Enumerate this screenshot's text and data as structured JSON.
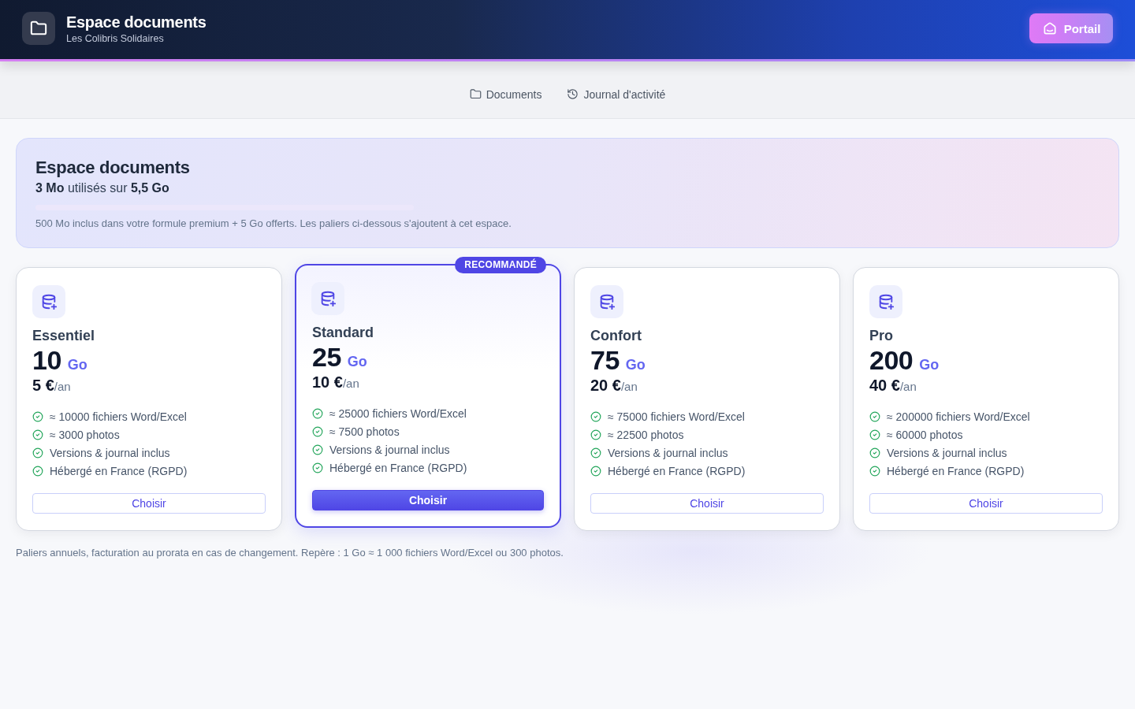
{
  "header": {
    "title": "Espace documents",
    "subtitle": "Les Colibris Solidaires",
    "button": "Portail"
  },
  "tabs": [
    {
      "kind": "folder",
      "label": "Documents",
      "selected": false
    },
    {
      "kind": "history",
      "label": "Journal d'activité",
      "selected": false
    }
  ],
  "usage": {
    "title": "Espace documents",
    "summary": "**3 Mo** utilisés sur **5,5 Go**",
    "level": 0.0005,
    "note": "500 Mo inclus dans votre formule premium + 5 Go offerts. Les paliers ci-dessous s'ajoutent à cet espace."
  },
  "plans": [
    {
      "name": "Essentiel",
      "size": "10",
      "unit": "Go",
      "price": "5 €",
      "period": "/an",
      "recommended": false,
      "features": [
        "≈ 10000 fichiers Word/Excel",
        "≈ 3000 photos",
        "Versions & journal inclus",
        "Hébergé en France (RGPD)"
      ],
      "button": "Choisir"
    },
    {
      "name": "Standard",
      "size": "25",
      "unit": "Go",
      "price": "10 €",
      "period": "/an",
      "recommended": true,
      "badge": "RECOMMANDÉ",
      "features": [
        "≈ 25000 fichiers Word/Excel",
        "≈ 7500 photos",
        "Versions & journal inclus",
        "Hébergé en France (RGPD)"
      ],
      "button": "Choisir"
    },
    {
      "name": "Confort",
      "size": "75",
      "unit": "Go",
      "price": "20 €",
      "period": "/an",
      "recommended": false,
      "features": [
        "≈ 75000 fichiers Word/Excel",
        "≈ 22500 photos",
        "Versions & journal inclus",
        "Hébergé en France (RGPD)"
      ],
      "button": "Choisir"
    },
    {
      "name": "Pro",
      "size": "200",
      "unit": "Go",
      "price": "40 €",
      "period": "/an",
      "recommended": false,
      "features": [
        "≈ 200000 fichiers Word/Excel",
        "≈ 60000 photos",
        "Versions & journal inclus",
        "Hébergé en France (RGPD)"
      ],
      "button": "Choisir"
    }
  ],
  "footnote": "Paliers annuels, facturation au prorata en cas de changement. Repère : 1 Go ≈ 1 000 fichiers Word/Excel ou 300 photos."
}
